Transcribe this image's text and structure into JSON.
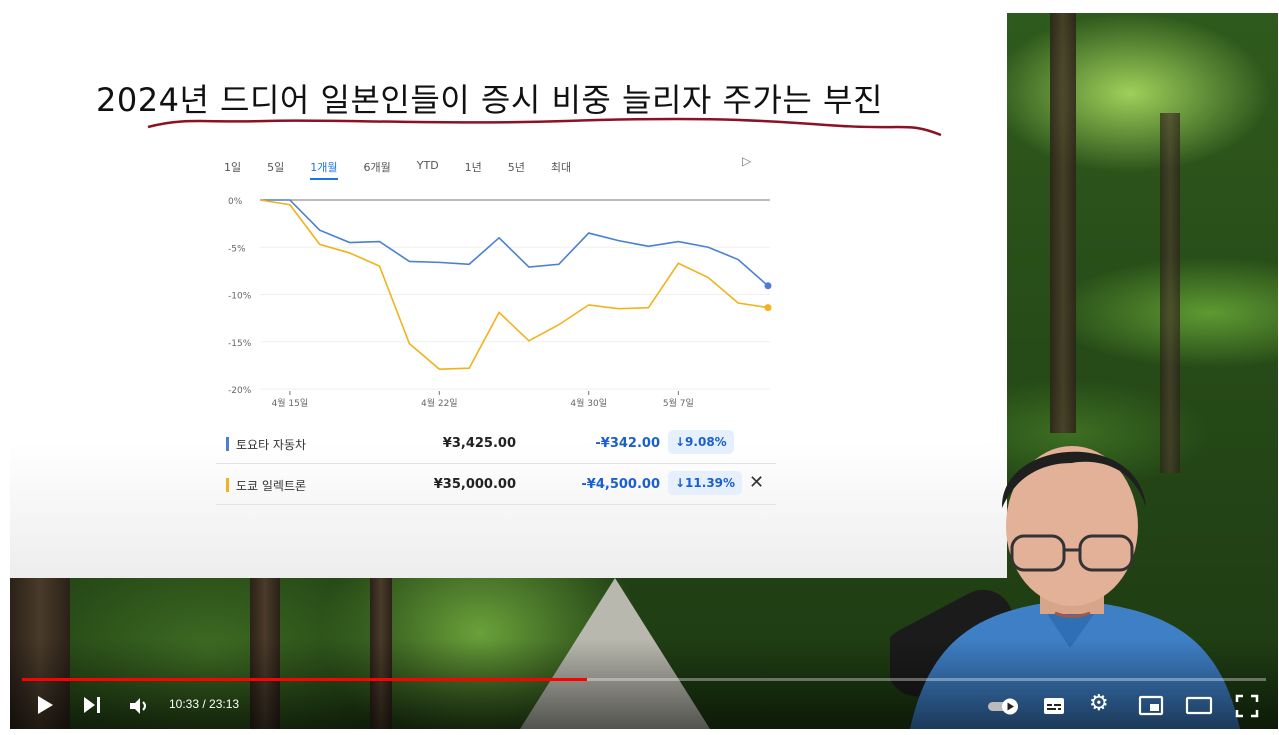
{
  "slide": {
    "title": "2024년 드디어 일본인들이 증시 비중 늘리자 주가는 부진",
    "periods": [
      "1일",
      "5일",
      "1개월",
      "6개월",
      "YTD",
      "1년",
      "5년",
      "최대"
    ],
    "active_period": "1개월"
  },
  "chart_data": {
    "type": "line",
    "yticks": [
      "0%",
      "-5%",
      "-10%",
      "-15%",
      "-20%"
    ],
    "ylim": [
      -20,
      0
    ],
    "xticks": [
      "4월 15일",
      "4월 22일",
      "4월 30일",
      "5월 7일"
    ],
    "x": [
      "4월 12일",
      "4월 15일",
      "4월 16일",
      "4월 17일",
      "4월 18일",
      "4월 19일",
      "4월 22일",
      "4월 23일",
      "4월 24일",
      "4월 25일",
      "4월 26일",
      "4월 30일",
      "5월 1일",
      "5월 2일",
      "5월 7일",
      "5월 8일",
      "5월 9일",
      "5월 10일"
    ],
    "xtick_index": [
      1,
      6,
      11,
      14
    ],
    "series": [
      {
        "name": "토요타 자동차",
        "color": "#4a7fd4",
        "values": [
          0,
          0,
          -3.2,
          -4.5,
          -4.4,
          -6.5,
          -6.6,
          -6.8,
          -4.0,
          -7.1,
          -6.8,
          -3.5,
          -4.3,
          -4.9,
          -4.4,
          -5.0,
          -6.3,
          -9.08
        ]
      },
      {
        "name": "도쿄 일렉트론",
        "color": "#f2b21b",
        "values": [
          0,
          -0.5,
          -4.7,
          -5.6,
          -7.0,
          -15.2,
          -17.9,
          -17.8,
          -11.9,
          -14.9,
          -13.2,
          -11.1,
          -11.5,
          -11.4,
          -6.7,
          -8.2,
          -10.9,
          -11.39
        ]
      }
    ]
  },
  "stocks": [
    {
      "name": "토요타 자동차",
      "price": "¥3,425.00",
      "change": "-¥342.00",
      "pct": "↓9.08%",
      "color": "#4a7fd4"
    },
    {
      "name": "도쿄 일렉트론",
      "price": "¥35,000.00",
      "change": "-¥4,500.00",
      "pct": "↓11.39%",
      "color": "#f2b21b",
      "remove": "✕"
    }
  ],
  "player": {
    "time": "10:33 / 23:13",
    "progress": 0.454,
    "accent": "#ff0000"
  }
}
